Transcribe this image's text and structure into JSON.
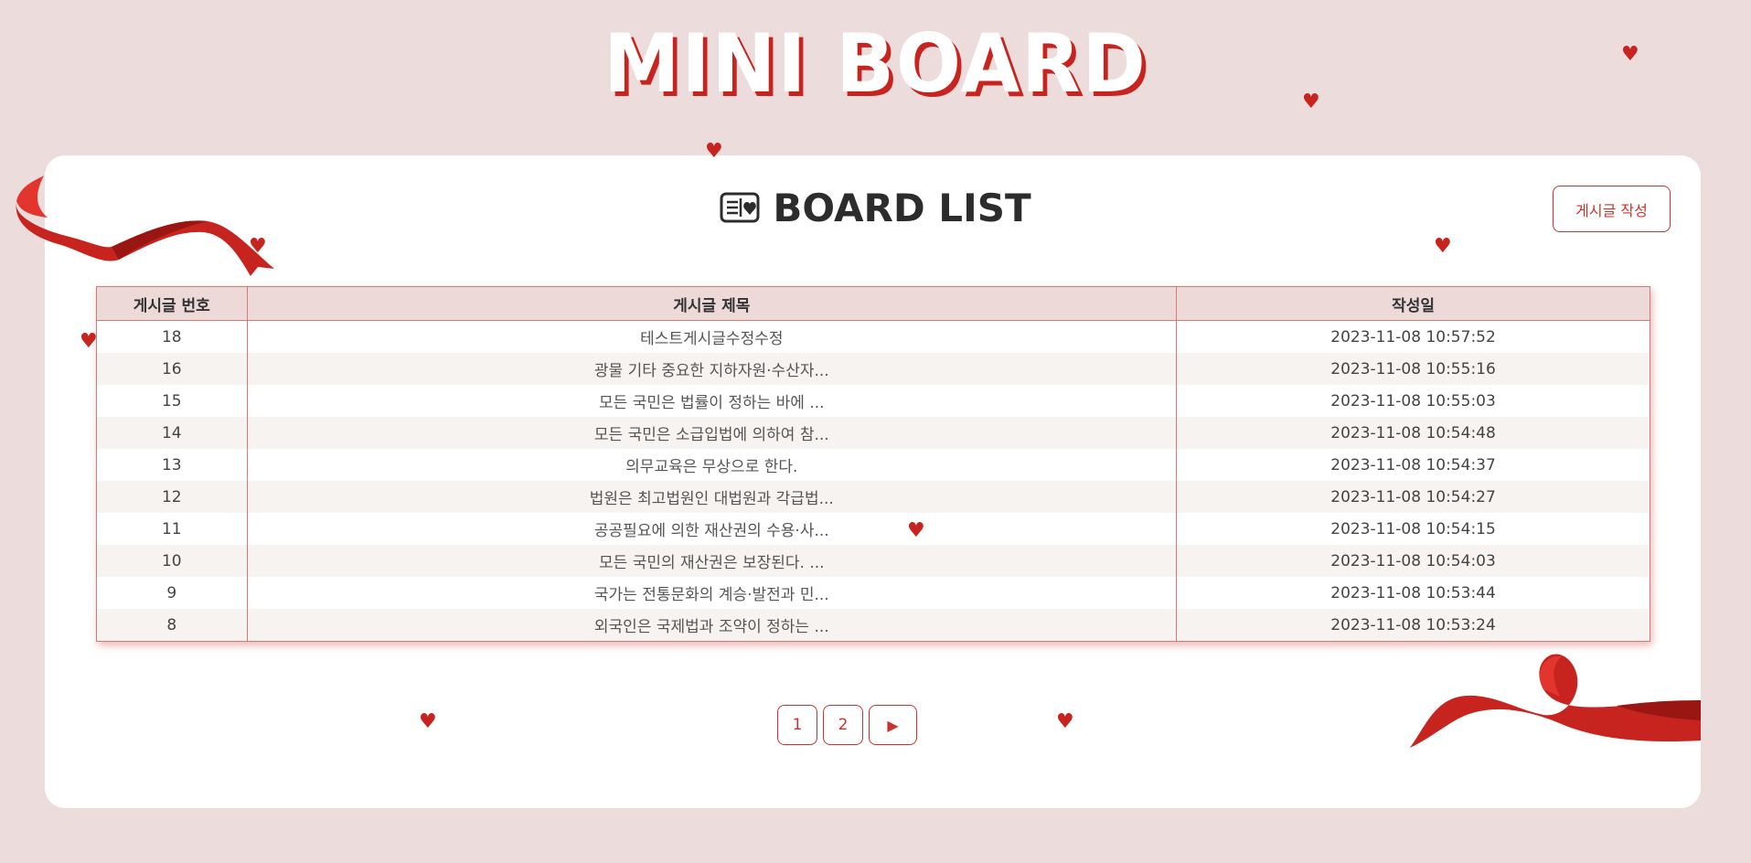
{
  "header": {
    "site_title": "MINI BOARD"
  },
  "board": {
    "heading": "BOARD LIST",
    "write_button_label": "게시글 작성",
    "columns": [
      "게시글 번호",
      "게시글 제목",
      "작성일"
    ],
    "rows": [
      {
        "no": "18",
        "title": "테스트게시글수정수정",
        "date": "2023-11-08 10:57:52"
      },
      {
        "no": "16",
        "title": "광물 기타 중요한 지하자원·수산자...",
        "date": "2023-11-08 10:55:16"
      },
      {
        "no": "15",
        "title": "모든 국민은 법률이 정하는 바에 ...",
        "date": "2023-11-08 10:55:03"
      },
      {
        "no": "14",
        "title": "모든 국민은 소급입법에 의하여 참...",
        "date": "2023-11-08 10:54:48"
      },
      {
        "no": "13",
        "title": "의무교육은 무상으로 한다.",
        "date": "2023-11-08 10:54:37"
      },
      {
        "no": "12",
        "title": "법원은 최고법원인 대법원과 각급법...",
        "date": "2023-11-08 10:54:27"
      },
      {
        "no": "11",
        "title": "공공필요에 의한 재산권의 수용·사...",
        "date": "2023-11-08 10:54:15"
      },
      {
        "no": "10",
        "title": "모든 국민의 재산권은 보장된다. ...",
        "date": "2023-11-08 10:54:03"
      },
      {
        "no": "9",
        "title": "국가는 전통문화의 계승·발전과 민...",
        "date": "2023-11-08 10:53:44"
      },
      {
        "no": "8",
        "title": "외국인은 국제법과 조약이 정하는 ...",
        "date": "2023-11-08 10:53:24"
      }
    ]
  },
  "pagination": {
    "pages": [
      "1",
      "2"
    ],
    "next_icon": "▶"
  },
  "decor": {
    "heart_glyph": "♥",
    "accent_color": "#c8241f",
    "background_color": "#ecdcdb"
  }
}
